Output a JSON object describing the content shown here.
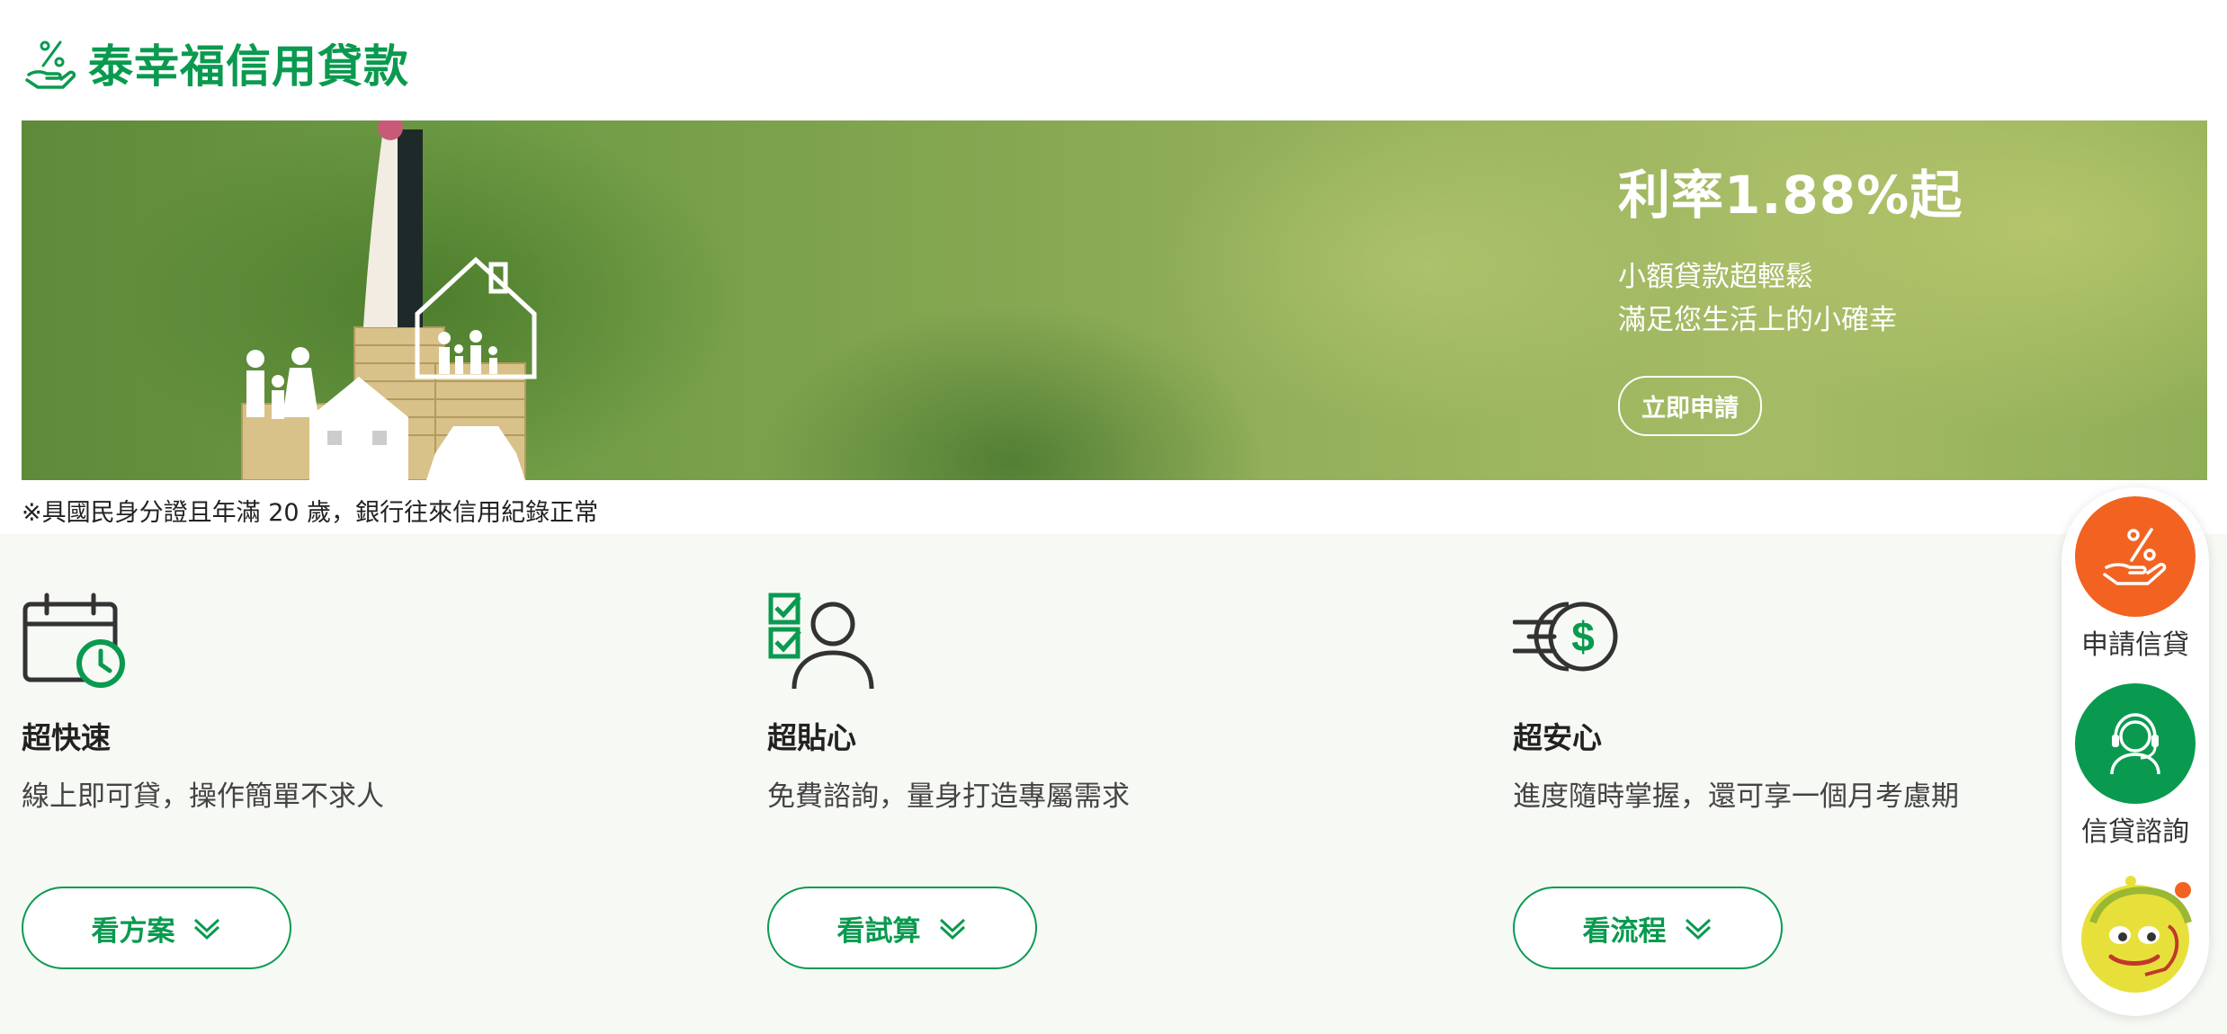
{
  "header": {
    "title": "泰幸福信用貸款",
    "logo_icon": "hand-percent-icon"
  },
  "banner": {
    "headline": "利率1.88%起",
    "line1": "小額貸款超輕鬆",
    "line2": "滿足您生活上的小確幸",
    "cta": "立即申請"
  },
  "notice": "※具國民身分證且年滿 20 歲，銀行往來信用紀錄正常",
  "features": [
    {
      "icon": "calendar-clock-icon",
      "title": "超快速",
      "desc": "線上即可貸，操作簡單不求人",
      "button": "看方案"
    },
    {
      "icon": "checklist-person-icon",
      "title": "超貼心",
      "desc": "免費諮詢，量身打造專屬需求",
      "button": "看試算"
    },
    {
      "icon": "fast-dollar-icon",
      "title": "超安心",
      "desc": "進度隨時掌握，還可享一個月考慮期",
      "button": "看流程"
    }
  ],
  "floating": {
    "apply_label": "申請信貸",
    "consult_label": "信貸諮詢"
  },
  "colors": {
    "brand_green": "#0a9a4f",
    "accent_orange": "#f26322"
  }
}
